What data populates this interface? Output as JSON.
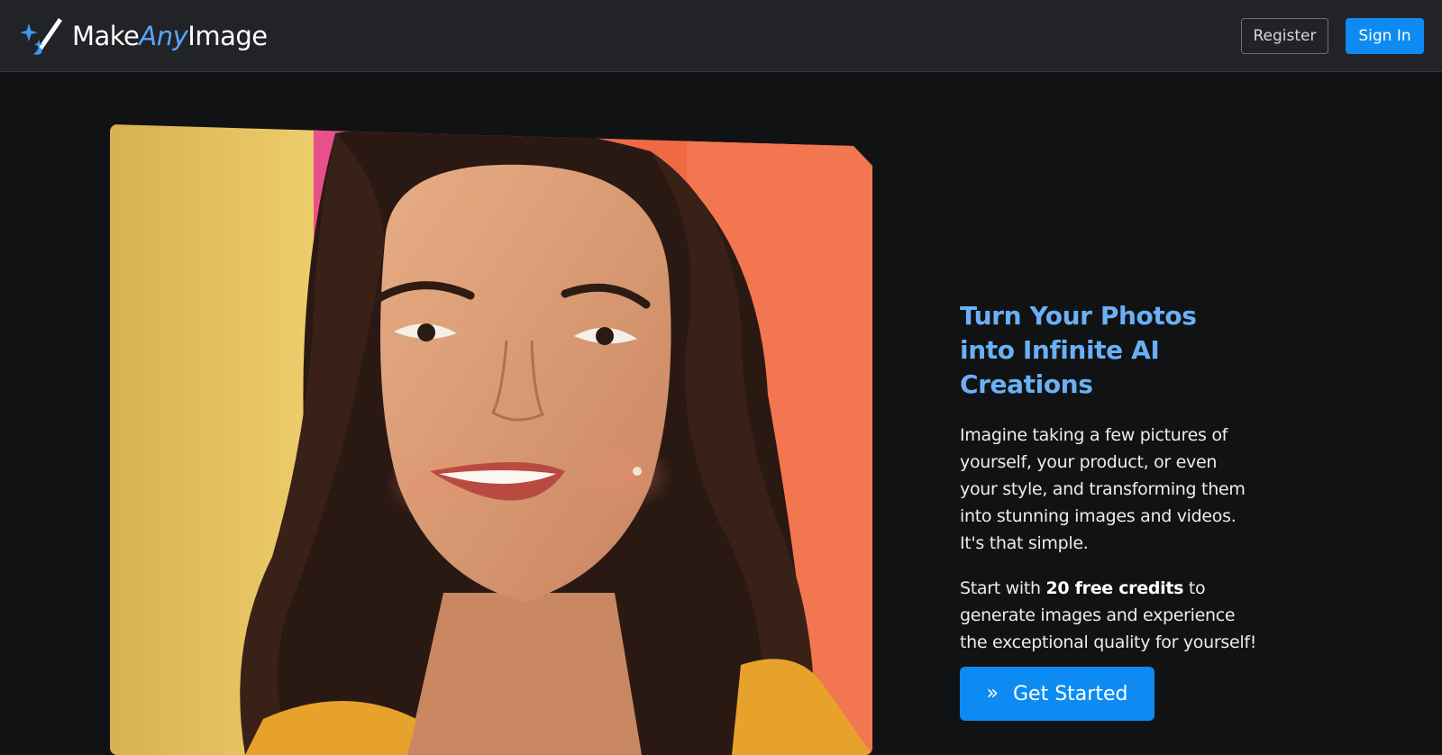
{
  "header": {
    "brand": {
      "part1": "Make",
      "part2": "Any",
      "part3": "Image",
      "icon": "magic-wand-sparkles-icon"
    },
    "register_label": "Register",
    "signin_label": "Sign In"
  },
  "hero": {
    "title": "Turn Your Photos into Infinite AI Creations",
    "paragraph1": "Imagine taking a few pictures of yourself, your product, or even your style, and transforming them into stunning images and videos. It's that simple.",
    "paragraph2": {
      "before": "Start with ",
      "bold": "20 free credits",
      "after": " to generate images and experience the exceptional quality for yourself!"
    },
    "cta_label": "Get Started",
    "cta_icon": "double-chevron-right-icon"
  },
  "colors": {
    "accent": "#0d8bf2",
    "title": "#6ab0f5",
    "background": "#111214",
    "navbar": "#212327"
  }
}
